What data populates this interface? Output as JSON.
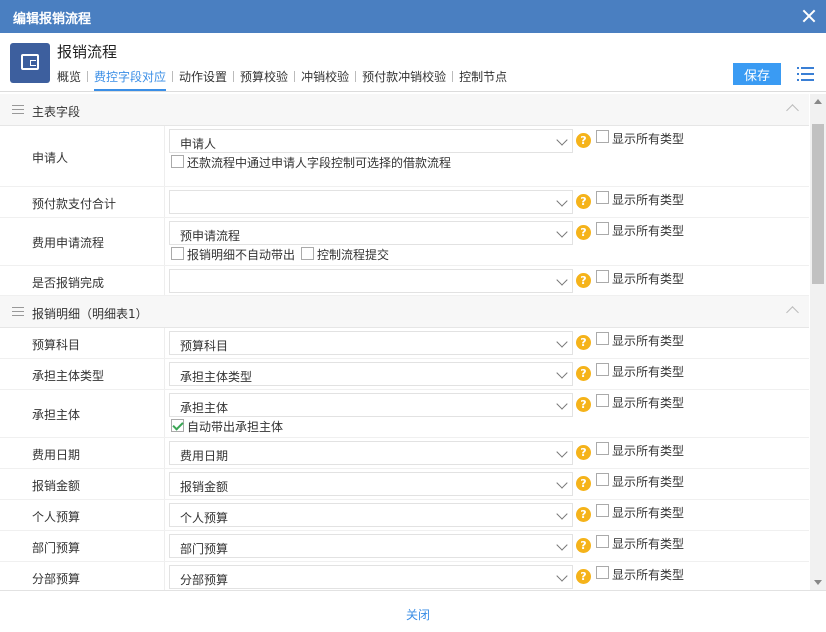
{
  "window": {
    "title": "编辑报销流程"
  },
  "header": {
    "page_title": "报销流程",
    "tabs": [
      {
        "label": "概览"
      },
      {
        "label": "费控字段对应",
        "active": true
      },
      {
        "label": "动作设置"
      },
      {
        "label": "预算校验"
      },
      {
        "label": "冲销校验"
      },
      {
        "label": "预付款冲销校验"
      },
      {
        "label": "控制节点"
      }
    ],
    "save_label": "保存"
  },
  "show_all_types_label": "显示所有类型",
  "sections": [
    {
      "title": "主表字段",
      "rows": [
        {
          "label": "申请人",
          "value": "申请人",
          "extra": [
            {
              "label": "还款流程中通过申请人字段控制可选择的借款流程",
              "checked": false
            }
          ]
        },
        {
          "label": "预付款支付合计",
          "value": ""
        },
        {
          "label": "费用申请流程",
          "value": "预申请流程",
          "extra": [
            {
              "label": "报销明细不自动带出",
              "checked": false
            },
            {
              "label": "控制流程提交",
              "checked": false
            }
          ]
        },
        {
          "label": "是否报销完成",
          "value": ""
        }
      ]
    },
    {
      "title": "报销明细（明细表1）",
      "rows": [
        {
          "label": "预算科目",
          "value": "预算科目"
        },
        {
          "label": "承担主体类型",
          "value": "承担主体类型"
        },
        {
          "label": "承担主体",
          "value": "承担主体",
          "extra": [
            {
              "label": "自动带出承担主体",
              "checked": true
            }
          ]
        },
        {
          "label": "费用日期",
          "value": "费用日期"
        },
        {
          "label": "报销金额",
          "value": "报销金额"
        },
        {
          "label": "个人预算",
          "value": "个人预算"
        },
        {
          "label": "部门预算",
          "value": "部门预算"
        },
        {
          "label": "分部预算",
          "value": "分部预算"
        },
        {
          "label": "",
          "value": ""
        }
      ]
    }
  ],
  "footer": {
    "close_label": "关闭"
  }
}
